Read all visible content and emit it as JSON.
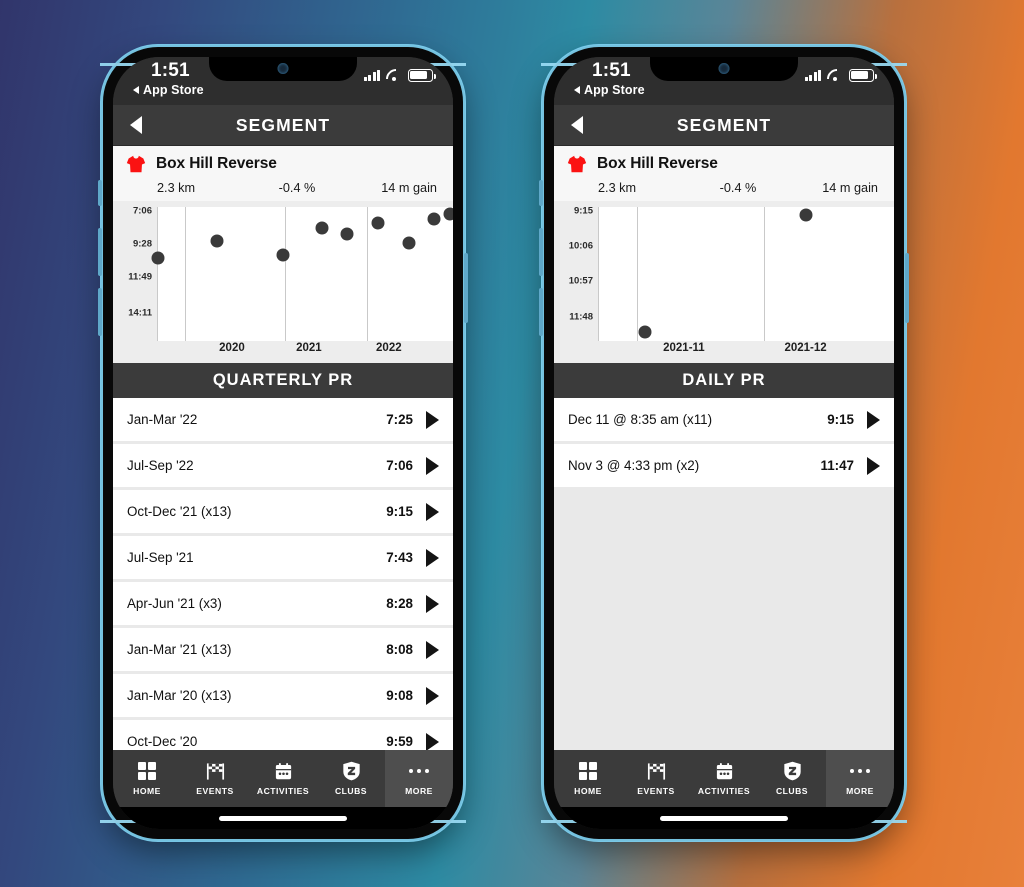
{
  "background": {
    "from": "#31356b",
    "mid": "#2d8ba3",
    "to": "#e8803a"
  },
  "phones": [
    {
      "id": "left",
      "status_bar": {
        "time": "1:51",
        "back_app": "App Store",
        "icons": [
          "signal-icon",
          "wifi-icon",
          "battery-icon"
        ]
      },
      "nav": {
        "back": "back-arrow-icon",
        "title": "SEGMENT"
      },
      "segment": {
        "jersey_color": "#fb1212",
        "name": "Box Hill Reverse",
        "distance": "2.3 km",
        "grade": "-0.4 %",
        "elevation": "14 m gain"
      },
      "chart_data": {
        "type": "scatter",
        "title": "Box Hill Reverse quarterly PR times",
        "xlabel": "",
        "ylabel": "",
        "grid": "vertical-year-dividers",
        "legend": "none",
        "ytick_labels": [
          "7:06",
          "9:28",
          "11:49",
          "14:11"
        ],
        "ytick_pct": [
          3,
          31,
          59,
          90
        ],
        "xtick_labels": [
          "2020",
          "2021",
          "2022"
        ],
        "xtick_pct": [
          21,
          47,
          74
        ],
        "divider_pct": [
          9,
          43,
          71
        ],
        "points": [
          {
            "x_pct": 0.0,
            "y_pct": 38,
            "label": "edge",
            "time": "10:00"
          },
          {
            "x_pct": 20.0,
            "y_pct": 25,
            "label": "2020 Q1",
            "time": "9:08"
          },
          {
            "x_pct": 42.5,
            "y_pct": 36,
            "label": "2020 Q4",
            "time": "9:59"
          },
          {
            "x_pct": 55.5,
            "y_pct": 16,
            "label": "2021 Q1",
            "time": "8:08"
          },
          {
            "x_pct": 64.0,
            "y_pct": 20,
            "label": "2021 Q2",
            "time": "8:28"
          },
          {
            "x_pct": 74.5,
            "y_pct": 12,
            "label": "2021 Q3",
            "time": "7:43"
          },
          {
            "x_pct": 85.0,
            "y_pct": 27,
            "label": "2021 Q4",
            "time": "9:15"
          },
          {
            "x_pct": 93.5,
            "y_pct": 9,
            "label": "2022 Q1",
            "time": "7:25"
          },
          {
            "x_pct": 99.0,
            "y_pct": 5,
            "label": "2022 Q3",
            "time": "7:06"
          }
        ]
      },
      "section_title": "QUARTERLY PR",
      "rows": [
        {
          "label": "Jan-Mar '22",
          "time": "7:25"
        },
        {
          "label": "Jul-Sep '22",
          "time": "7:06"
        },
        {
          "label": "Oct-Dec '21 (x13)",
          "time": "9:15"
        },
        {
          "label": "Jul-Sep '21",
          "time": "7:43"
        },
        {
          "label": "Apr-Jun '21 (x3)",
          "time": "8:28"
        },
        {
          "label": "Jan-Mar '21 (x13)",
          "time": "8:08"
        },
        {
          "label": "Jan-Mar '20 (x13)",
          "time": "9:08"
        },
        {
          "label": "Oct-Dec '20",
          "time": "9:59"
        }
      ],
      "tabs": [
        {
          "label": "HOME",
          "icon": "grid-icon",
          "active": false
        },
        {
          "label": "EVENTS",
          "icon": "checkered-flag-icon",
          "active": false
        },
        {
          "label": "ACTIVITIES",
          "icon": "calendar-icon",
          "active": false
        },
        {
          "label": "CLUBS",
          "icon": "zwift-shield-icon",
          "active": false
        },
        {
          "label": "MORE",
          "icon": "ellipsis-icon",
          "active": true
        }
      ]
    },
    {
      "id": "right",
      "status_bar": {
        "time": "1:51",
        "back_app": "App Store",
        "icons": [
          "signal-icon",
          "wifi-icon",
          "battery-icon"
        ]
      },
      "nav": {
        "back": "back-arrow-icon",
        "title": "SEGMENT"
      },
      "segment": {
        "jersey_color": "#fb1212",
        "name": "Box Hill Reverse",
        "distance": "2.3 km",
        "grade": "-0.4 %",
        "elevation": "14 m gain"
      },
      "chart_data": {
        "type": "scatter",
        "title": "Box Hill Reverse daily PR times",
        "xlabel": "",
        "ylabel": "",
        "grid": "vertical-month-dividers",
        "legend": "none",
        "ytick_labels": [
          "9:15",
          "10:06",
          "10:57",
          "11:48"
        ],
        "ytick_pct": [
          3,
          33,
          63,
          93
        ],
        "xtick_labels": [
          "2021-11",
          "2021-12"
        ],
        "xtick_pct": [
          22,
          63
        ],
        "divider_pct": [
          13,
          56
        ],
        "points": [
          {
            "x_pct": 15.5,
            "y_pct": 93,
            "label": "Nov 3 @ 4:33 pm",
            "time": "11:47"
          },
          {
            "x_pct": 70.0,
            "y_pct": 6,
            "label": "Dec 11 @ 8:35 am",
            "time": "9:15"
          }
        ]
      },
      "section_title": "DAILY PR",
      "rows": [
        {
          "label": "Dec 11 @ 8:35 am  (x11)",
          "time": "9:15"
        },
        {
          "label": "Nov 3 @ 4:33 pm  (x2)",
          "time": "11:47"
        }
      ],
      "tabs": [
        {
          "label": "HOME",
          "icon": "grid-icon",
          "active": false
        },
        {
          "label": "EVENTS",
          "icon": "checkered-flag-icon",
          "active": false
        },
        {
          "label": "ACTIVITIES",
          "icon": "calendar-icon",
          "active": false
        },
        {
          "label": "CLUBS",
          "icon": "zwift-shield-icon",
          "active": false
        },
        {
          "label": "MORE",
          "icon": "ellipsis-icon",
          "active": true
        }
      ]
    }
  ]
}
